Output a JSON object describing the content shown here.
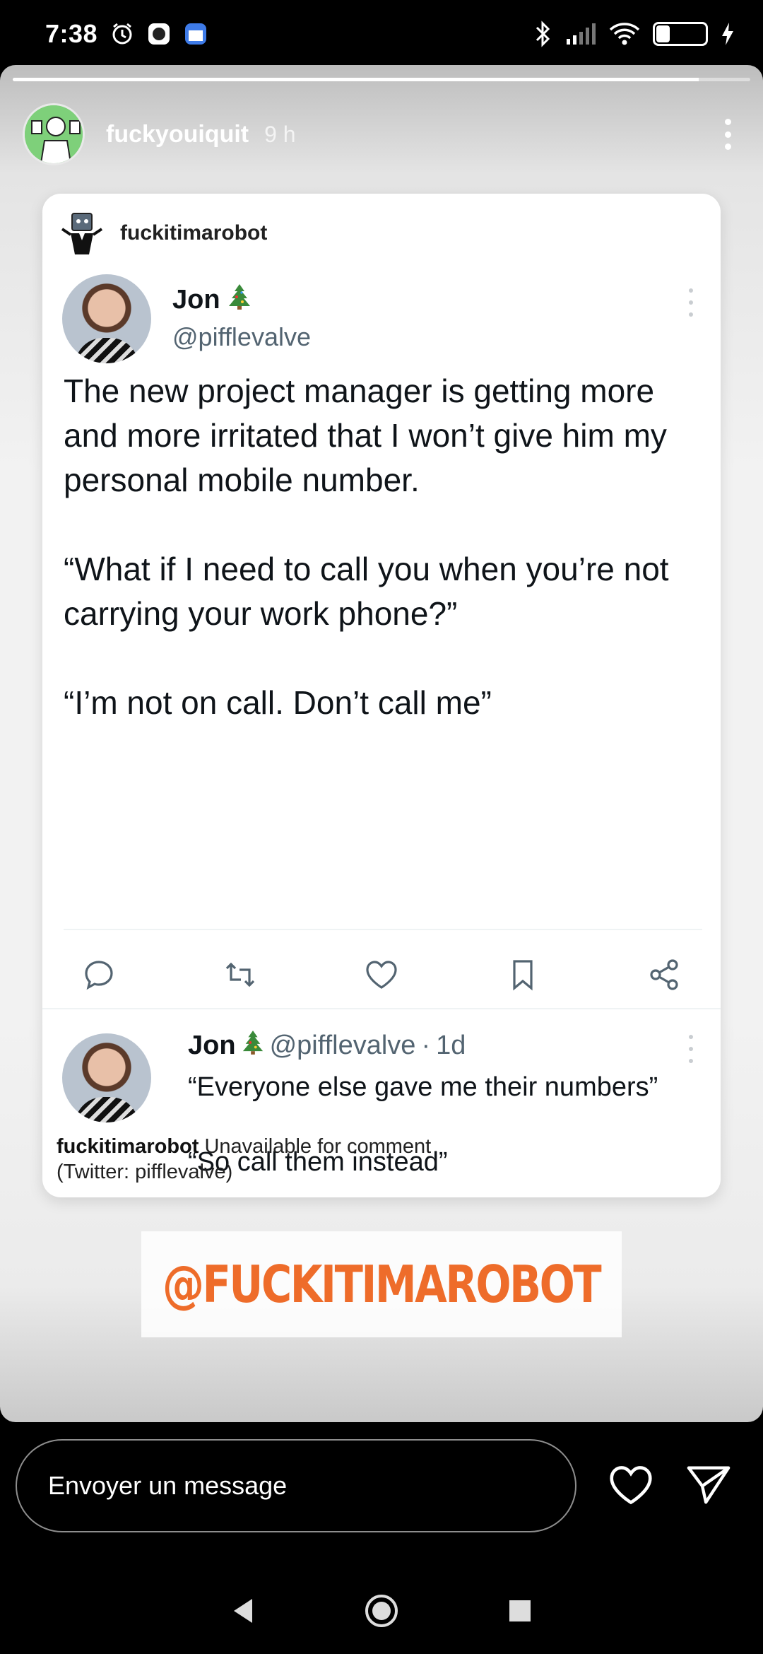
{
  "status_bar": {
    "time": "7:38",
    "left_icons": [
      "alarm-icon",
      "app-icon",
      "calendar-icon"
    ],
    "right_icons": [
      "bluetooth-icon",
      "signal-icon",
      "wifi-icon"
    ],
    "battery_level": 32,
    "battery_text": "32"
  },
  "story": {
    "progress": 0.93,
    "username": "fuckyouiquit",
    "time_ago": "9 h"
  },
  "card": {
    "repost_account": "fuckitimarobot",
    "tweet": {
      "name": "Jon",
      "name_emoji": "christmas-tree-icon",
      "handle": "@pifflevalve",
      "paragraphs": [
        "The new project manager is getting more and more irritated that I won’t give him my personal mobile number.",
        "“What if I need to call you when you’re not carrying your work phone?”",
        "“I’m not on call. Don’t call me”"
      ]
    },
    "actions": [
      "reply-icon",
      "retweet-icon",
      "like-icon",
      "bookmark-icon",
      "share-icon"
    ],
    "reply": {
      "name": "Jon",
      "handle": "@pifflevalve",
      "separator": "·",
      "time": "1d",
      "paragraphs": [
        "“Everyone else gave me their numbers”",
        "“So call them instead”"
      ]
    },
    "caption": {
      "account": "fuckitimarobot",
      "note": "Unavailable for comment",
      "source": "(Twitter: pifflevalve)"
    }
  },
  "sticker": {
    "text": "@FUCKITIMAROBOT",
    "color": "#ee6c2a"
  },
  "message_bar": {
    "placeholder": "Envoyer un message",
    "buttons": [
      "heart-icon",
      "send-icon"
    ]
  },
  "nav": [
    "back-icon",
    "home-icon",
    "recents-icon"
  ]
}
